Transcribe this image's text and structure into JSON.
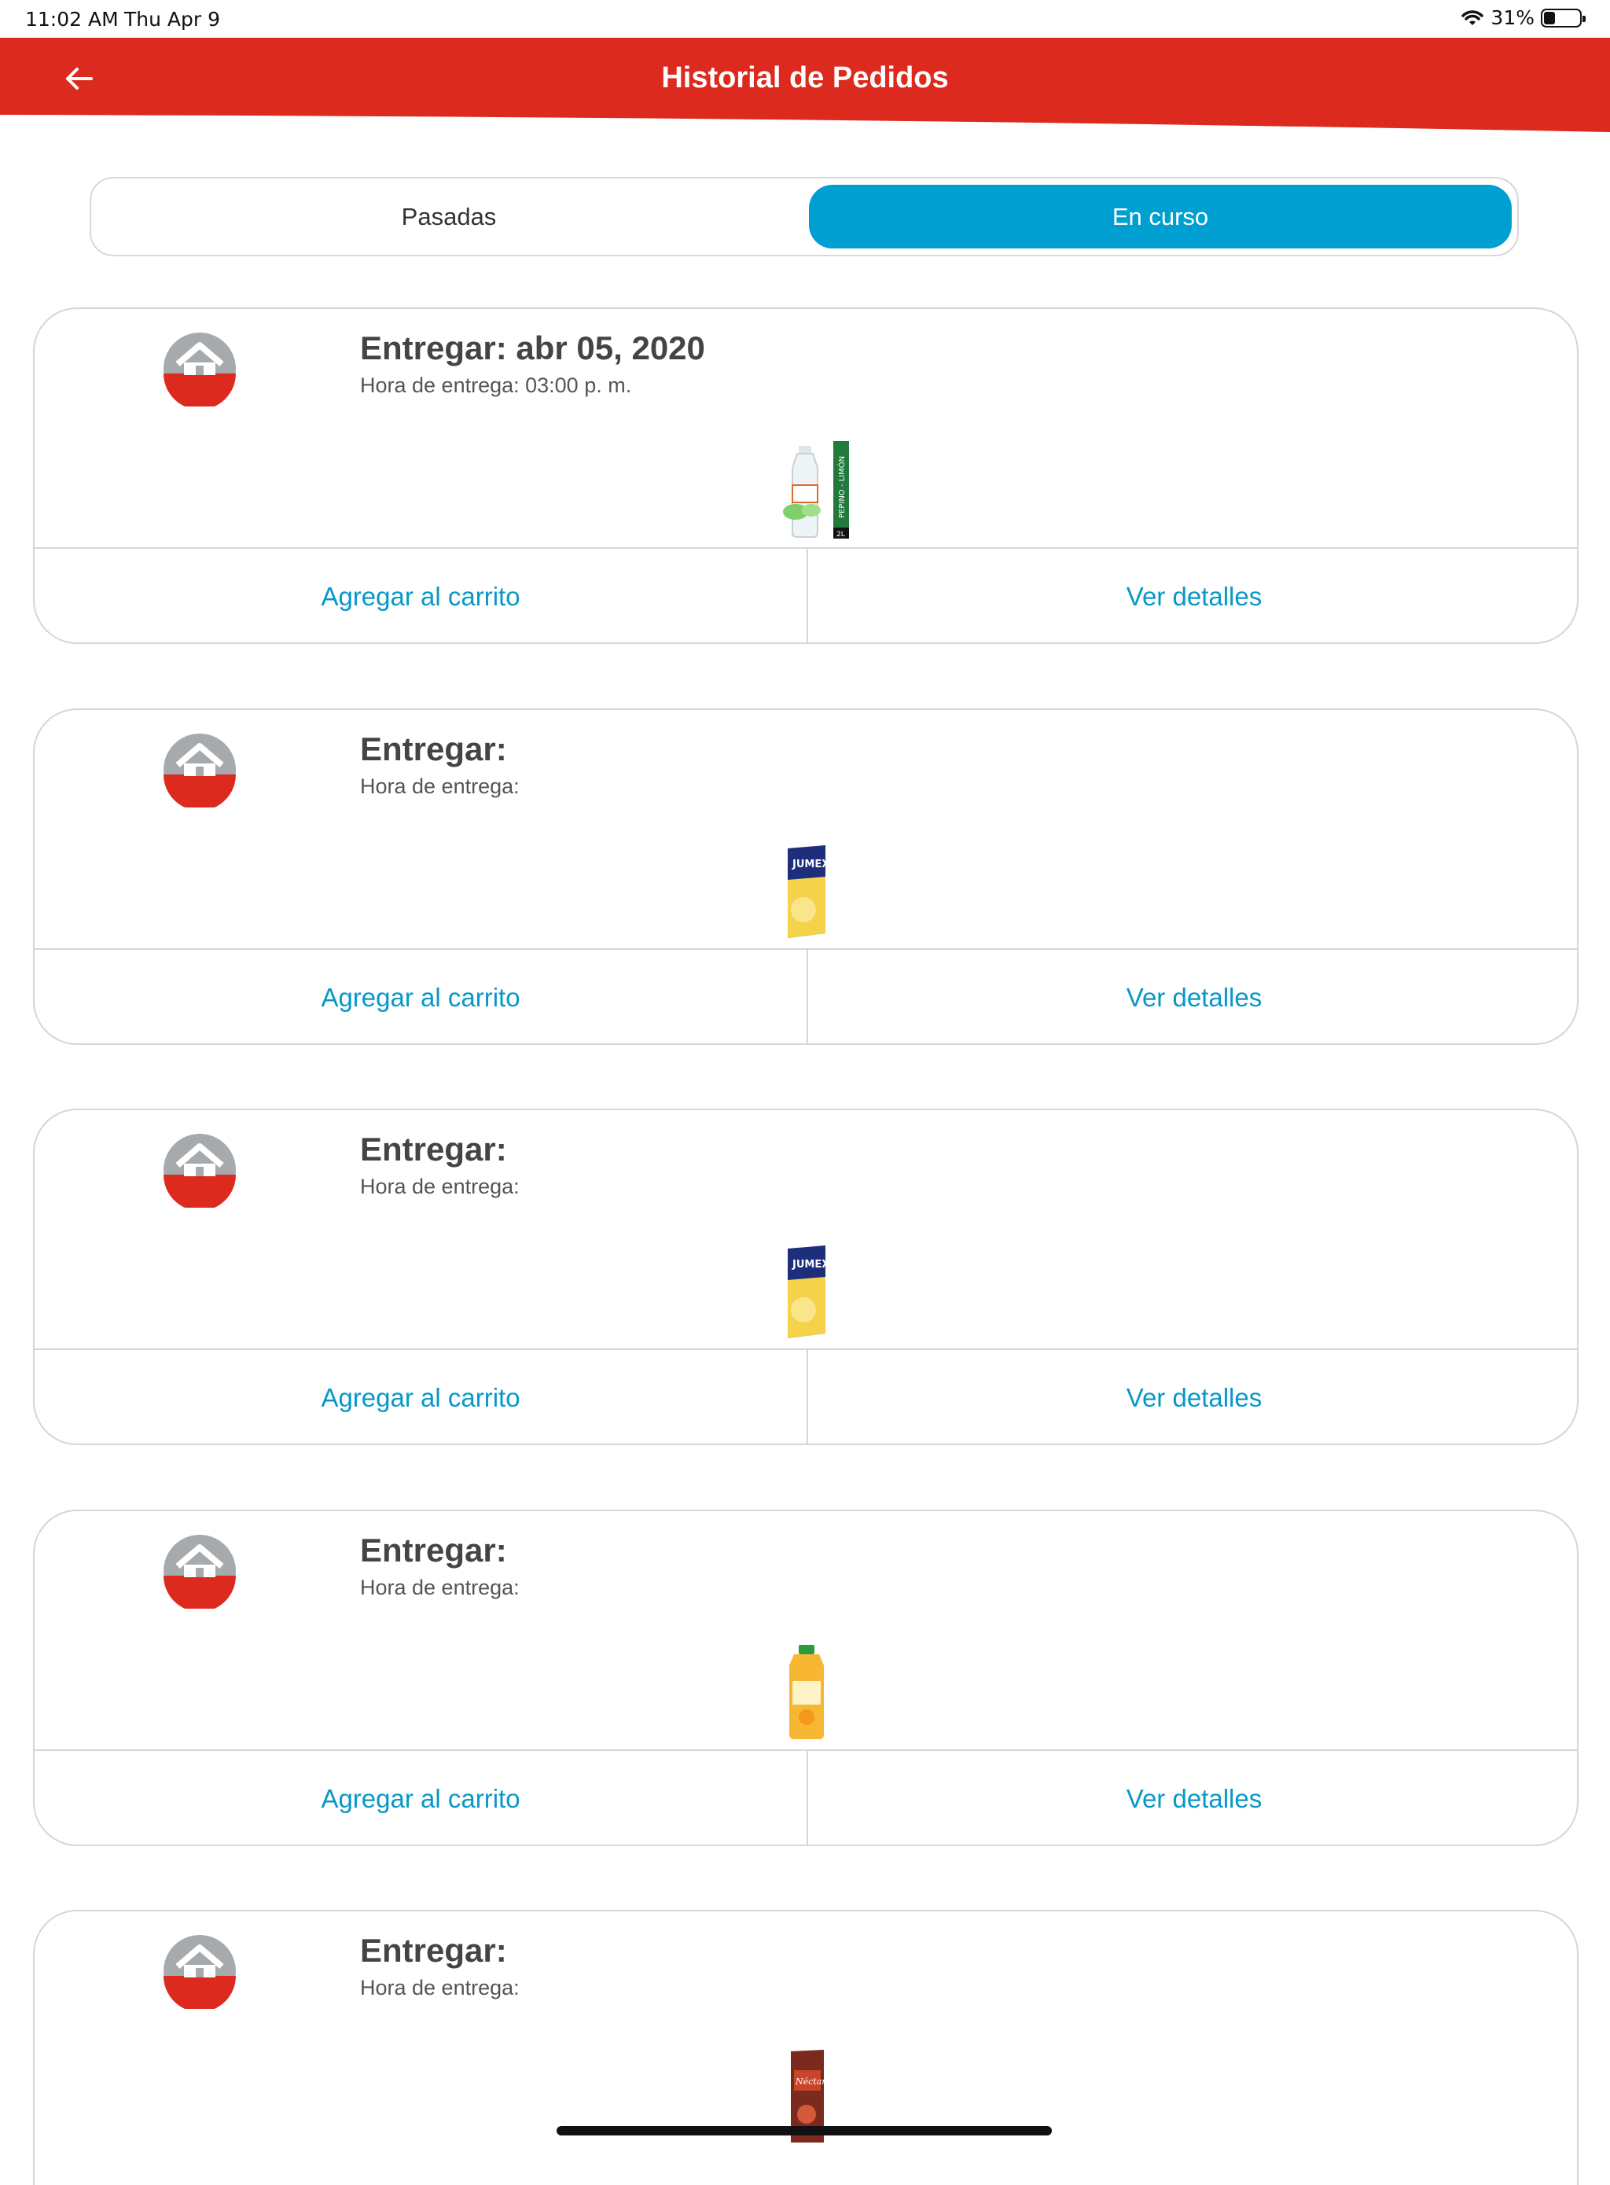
{
  "status_bar": {
    "time": "11:02 AM",
    "date": "Thu Apr 9",
    "battery": "31%",
    "battery_level": 0.31,
    "icons": [
      "wifi-icon",
      "battery-icon"
    ]
  },
  "header": {
    "title": "Historial de Pedidos",
    "back_icon": "arrow-left-icon",
    "color": "#dc2a1f"
  },
  "tabs": [
    {
      "label": "Pasadas",
      "selected": false
    },
    {
      "label": "En curso",
      "selected": true
    }
  ],
  "accent_color": "#009fd1",
  "orders": [
    {
      "title": "Entregar: abr 05, 2020",
      "subtitle": "Hora de entrega: 03:00 p. m.",
      "product": "water-bottle-thumbnail",
      "product_texts": [
        "PEPINO - LIMÓN",
        "2L"
      ],
      "add_to_cart": "Agregar al carrito",
      "details": "Ver detalles"
    },
    {
      "title": "Entregar:",
      "subtitle": "Hora de entrega:",
      "product": "juice-box-thumbnail",
      "product_texts": [
        "JUMEX"
      ],
      "add_to_cart": "Agregar al carrito",
      "details": "Ver detalles"
    },
    {
      "title": "Entregar:",
      "subtitle": "Hora de entrega:",
      "product": "juice-box-thumbnail",
      "product_texts": [
        "JUMEX"
      ],
      "add_to_cart": "Agregar al carrito",
      "details": "Ver detalles"
    },
    {
      "title": "Entregar:",
      "subtitle": "Hora de entrega:",
      "product": "orange-juice-bottle-thumbnail",
      "product_texts": [],
      "add_to_cart": "Agregar al carrito",
      "details": "Ver detalles"
    },
    {
      "title": "Entregar:",
      "subtitle": "Hora de entrega:",
      "product": "nectar-box-thumbnail",
      "product_texts": [
        "Néctar"
      ]
    }
  ]
}
